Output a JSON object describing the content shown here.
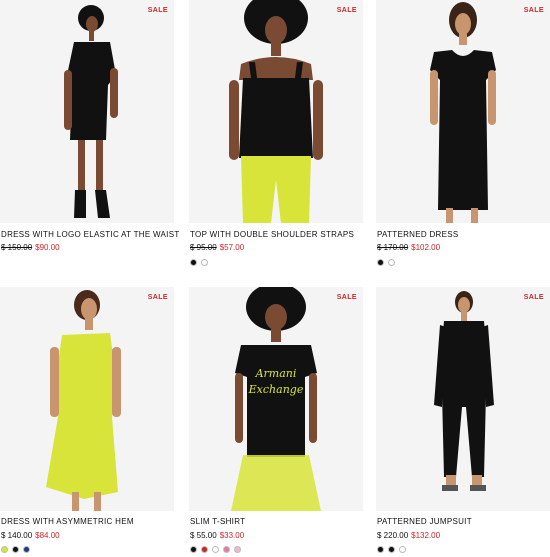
{
  "products": [
    {
      "sale_label": "SALE",
      "name": "DRESS WITH LOGO ELASTIC AT THE WAIST",
      "old_price": "$ 150.00",
      "price": "$90.00",
      "swatches": []
    },
    {
      "sale_label": "SALE",
      "name": "TOP WITH DOUBLE SHOULDER STRAPS",
      "old_price": "$ 95.00",
      "price": "$57.00",
      "swatches": [
        "#111111",
        "#ffffff"
      ]
    },
    {
      "sale_label": "SALE",
      "name": "PATTERNED DRESS",
      "old_price": "$ 170.00",
      "price": "$102.00",
      "swatches": [
        "#111111",
        "#ffffff"
      ]
    },
    {
      "sale_label": "SALE",
      "name": "DRESS WITH ASYMMETRIC HEM",
      "old_price": "$ 140.00",
      "price": "$84.00",
      "swatches": [
        "#d8e43a",
        "#111111",
        "#1f3b7a"
      ]
    },
    {
      "sale_label": "SALE",
      "name": "SLIM T-SHIRT",
      "old_price": "$ 55.00",
      "price": "$33.00",
      "swatches": [
        "#111111",
        "#c62828",
        "#ffffff",
        "#e87a9a",
        "#f0b8c8"
      ]
    },
    {
      "sale_label": "SALE",
      "name": "PATTERNED JUMPSUIT",
      "old_price": "$ 220.00",
      "price": "$132.00",
      "swatches": [
        "#111111",
        "#111111",
        "#ffffff"
      ]
    }
  ],
  "colors": {
    "sale_red": "#c62828",
    "image_bg": "#f3f3f3",
    "neon_yellow": "#d8e43a"
  }
}
